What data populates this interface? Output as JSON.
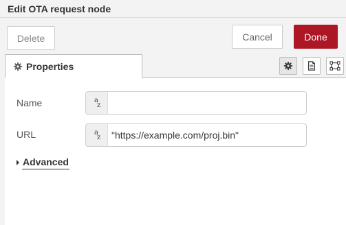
{
  "dialog": {
    "title": "Edit OTA request node"
  },
  "toolbar": {
    "delete_label": "Delete",
    "cancel_label": "Cancel",
    "done_label": "Done"
  },
  "tabs": {
    "properties_label": "Properties",
    "icons": [
      "gear-icon",
      "document-icon",
      "frame-icon"
    ]
  },
  "form": {
    "name": {
      "label": "Name",
      "type_icon": "string-az-icon",
      "value": ""
    },
    "url": {
      "label": "URL",
      "type_icon": "string-az-icon",
      "value": "\"https://example.com/proj.bin\""
    }
  },
  "advanced": {
    "label": "Advanced"
  },
  "colors": {
    "done_button": "#ad1625",
    "panel_background": "#f3f3f3"
  }
}
